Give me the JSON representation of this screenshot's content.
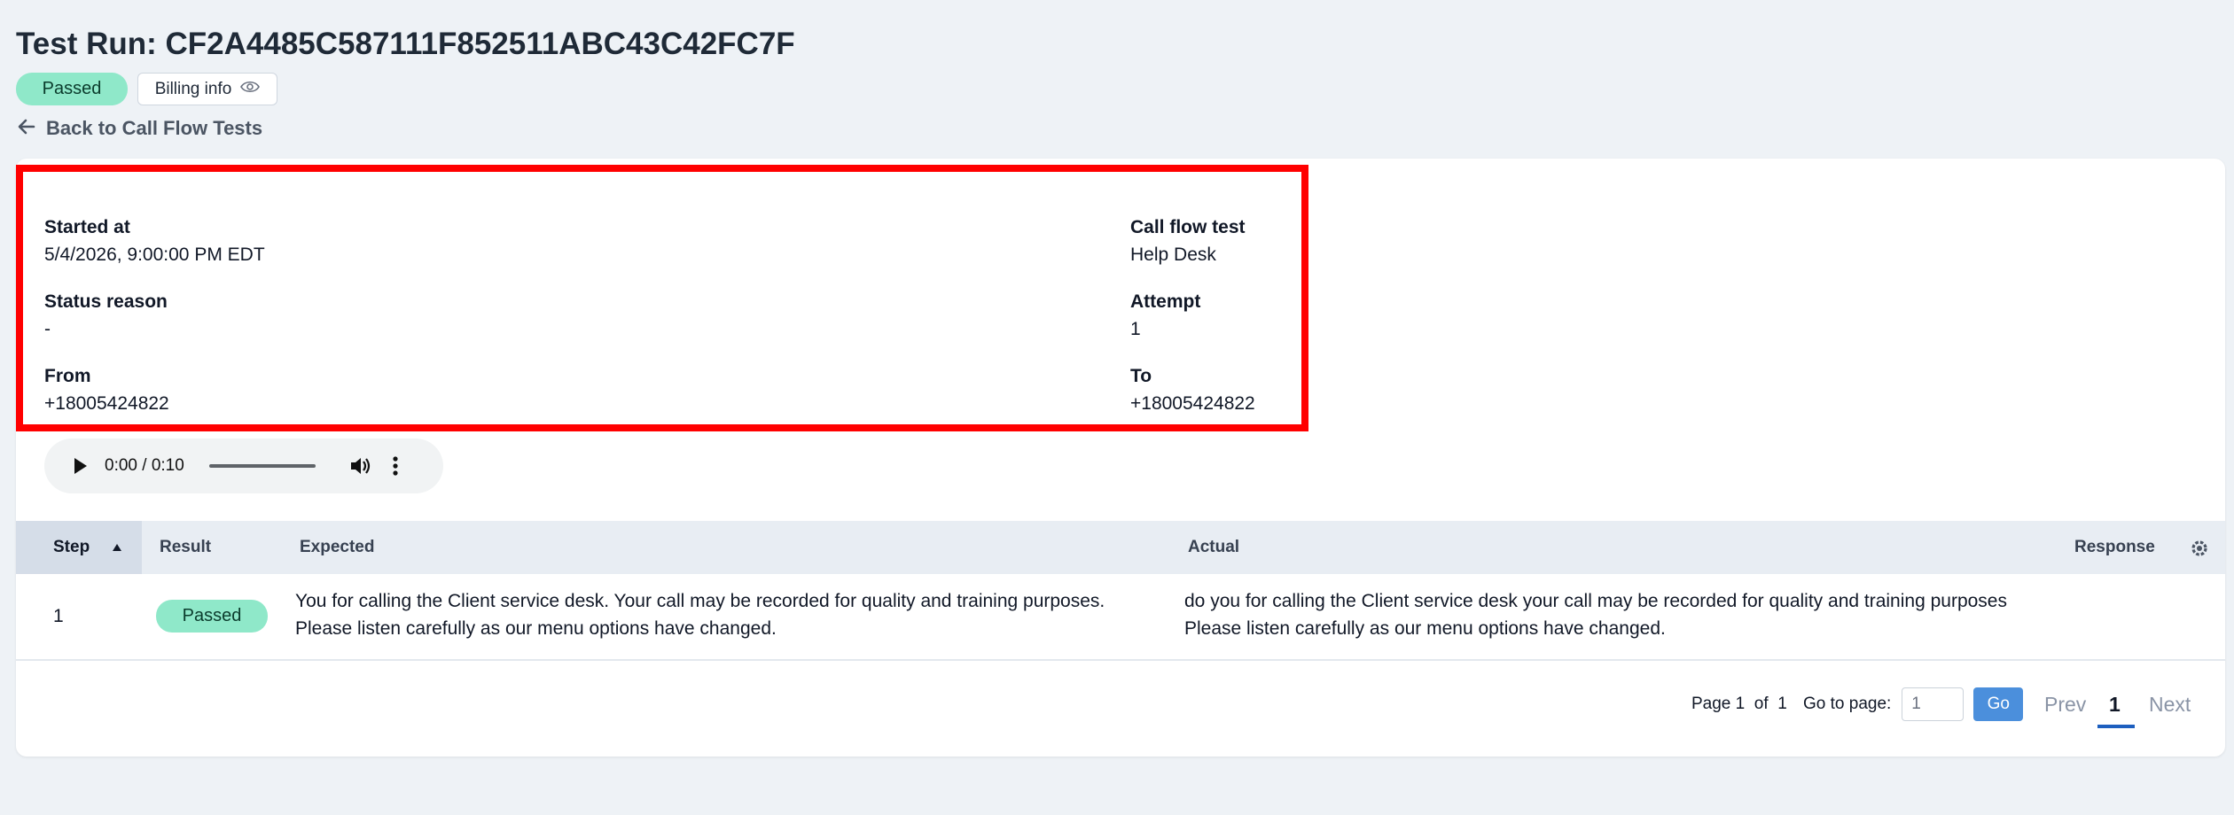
{
  "header": {
    "title": "Test Run: CF2A4485C587111F852511ABC43C42FC7F",
    "status_badge": "Passed",
    "billing_label": "Billing info",
    "back_label": "Back to Call Flow Tests"
  },
  "details": {
    "started_at_label": "Started at",
    "started_at_value": "5/4/2026, 9:00:00 PM EDT",
    "call_flow_test_label": "Call flow test",
    "call_flow_test_value": "Help Desk",
    "status_reason_label": "Status reason",
    "status_reason_value": "-",
    "attempt_label": "Attempt",
    "attempt_value": "1",
    "from_label": "From",
    "from_value": "+18005424822",
    "to_label": "To",
    "to_value": "+18005424822"
  },
  "audio": {
    "time": "0:00 / 0:10"
  },
  "table": {
    "columns": [
      "Step",
      "Result",
      "Expected",
      "Actual",
      "Response"
    ],
    "rows": [
      {
        "step": "1",
        "result": "Passed",
        "expected": "You for calling the Client service desk. Your call may be recorded for quality and training purposes. Please listen carefully as our menu options have changed.",
        "actual": "do you for calling the Client service desk your call may be recorded for quality and training purposes Please listen carefully as our menu options have changed."
      }
    ]
  },
  "pagination": {
    "page_word": "Page",
    "current": "1",
    "of_word": "of",
    "total": "1",
    "goto_label": "Go to page:",
    "goto_value": "1",
    "go_label": "Go",
    "prev_label": "Prev",
    "page_number": "1",
    "next_label": "Next"
  },
  "colors": {
    "accent": "#4b8fdc",
    "passed_bg": "#8fe8c9",
    "highlight": "#ff0000"
  }
}
